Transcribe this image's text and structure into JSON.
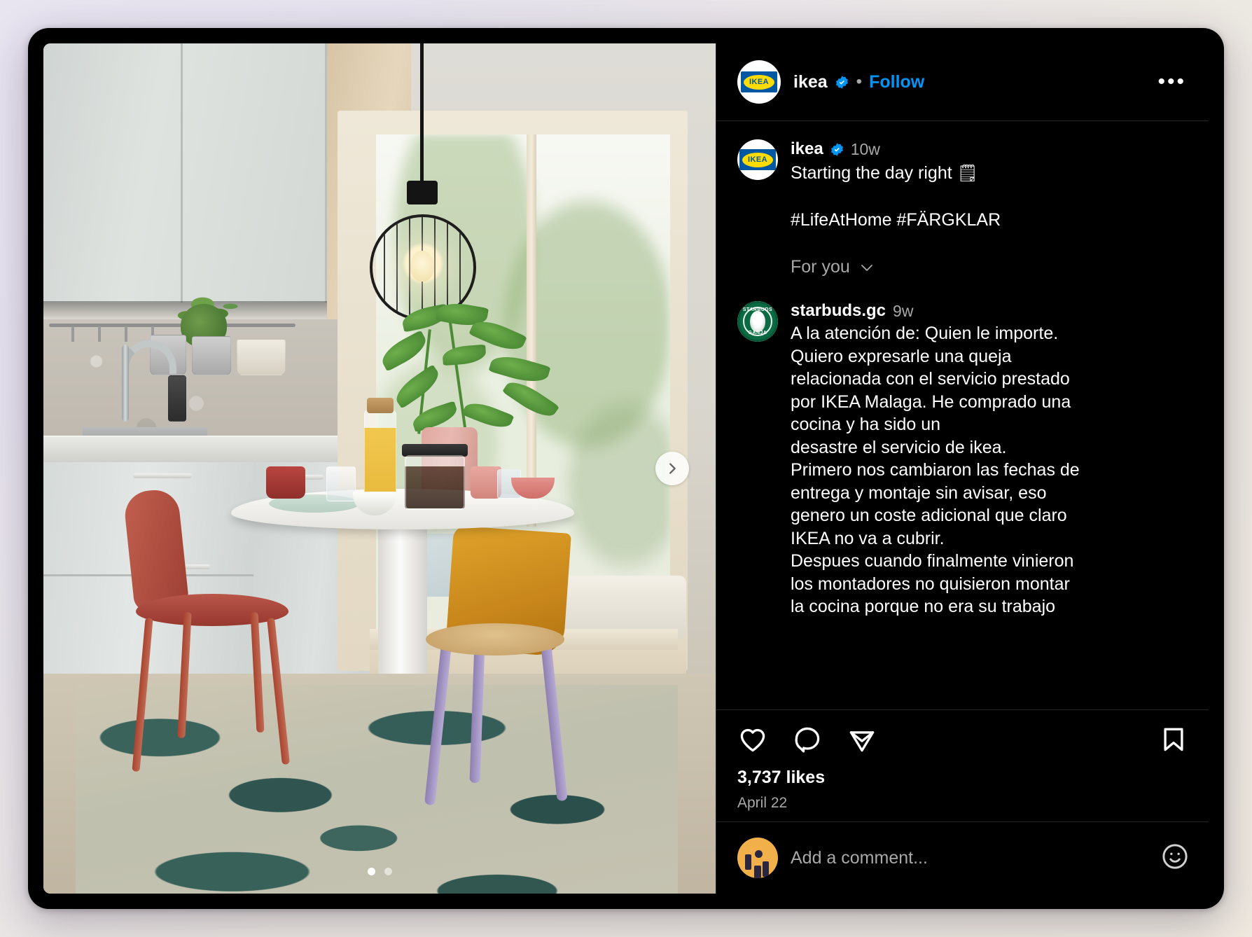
{
  "post": {
    "header": {
      "account": "ikea",
      "verified_icon": "verified-badge-icon",
      "separator": "•",
      "follow_label": "Follow",
      "more_label": "•••",
      "avatar_text": "IKEA"
    },
    "caption": {
      "account": "ikea",
      "time_ago": "10w",
      "text": "Starting the day right",
      "emoji": "🗒",
      "hashtags": "#LifeAtHome #FÄRGKLAR"
    },
    "for_you": {
      "label": "For you",
      "chevron_icon": "chevron-down-icon"
    },
    "comment": {
      "account": "starbuds.gc",
      "time_ago": "9w",
      "avatar_top_text": "STARBUDS",
      "avatar_bottom_text": "GANJA",
      "text": "A la atención de: Quien le importe.\nQuiero expresarle una queja\nrelacionada con el servicio prestado\npor IKEA Malaga. He comprado una\ncocina y ha sido un\ndesastre el servicio de ikea.\nPrimero nos cambiaron las fechas de\nentrega y montaje sin avisar, eso\ngenero un coste adicional que claro\nIKEA no va a cubrir.\nDespues cuando finalmente vinieron\nlos montadores no quisieron montar\nla cocina porque no era su trabajo"
    },
    "actions": {
      "like_icon": "heart-icon",
      "comment_icon": "comment-bubble-icon",
      "share_icon": "share-paper-plane-icon",
      "save_icon": "bookmark-icon",
      "likes": "3,737 likes",
      "date": "April 22"
    },
    "composer": {
      "placeholder": "Add a comment...",
      "emoji_picker_icon": "smiley-face-icon",
      "avatar_icon": "emoji-avatar"
    },
    "media": {
      "next_icon": "chevron-right-icon",
      "dots_total": 2,
      "active_dot": 1
    },
    "colors": {
      "accent_blue": "#0095f6",
      "background": "#000000",
      "muted_text": "#a8a8a8",
      "divider": "#262626",
      "ikea_blue": "#0058a3",
      "ikea_yellow": "#ffdb00"
    }
  }
}
